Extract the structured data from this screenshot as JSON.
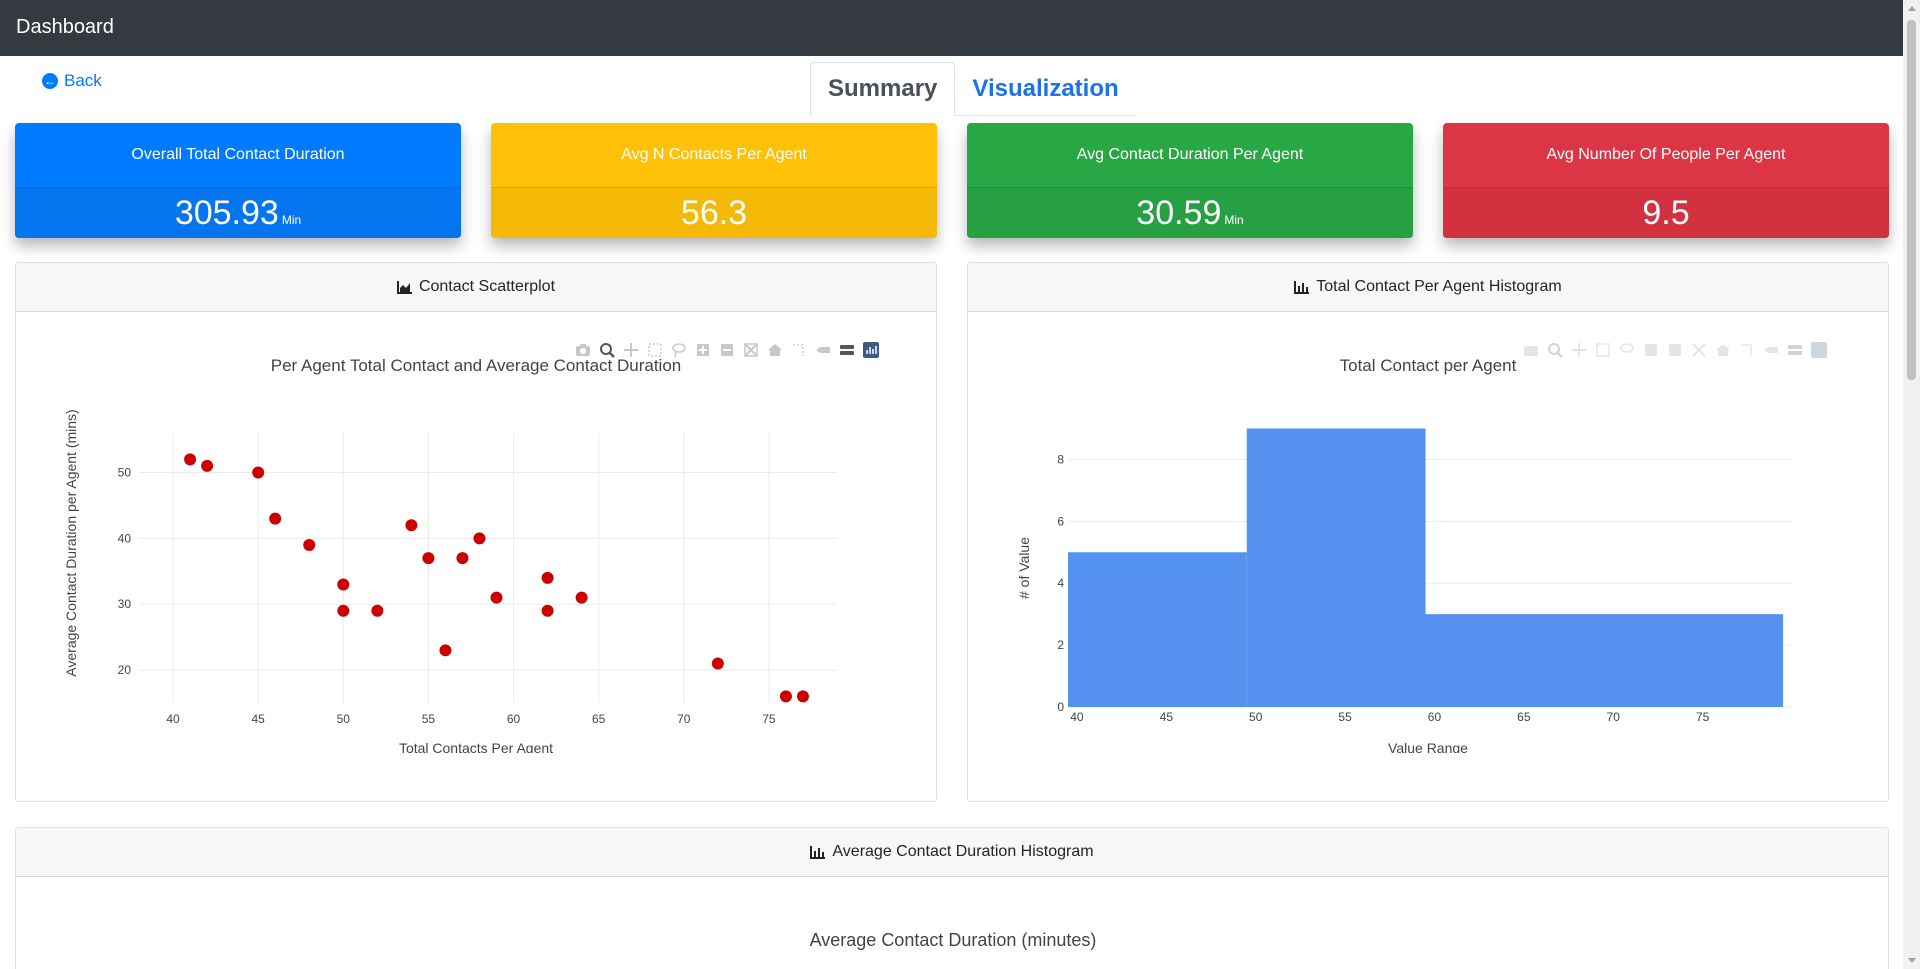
{
  "navbar": {
    "brand": "Dashboard"
  },
  "back": {
    "label": "Back"
  },
  "tabs": [
    {
      "label": "Summary",
      "active": true
    },
    {
      "label": "Visualization",
      "active": false
    }
  ],
  "stats": [
    {
      "title": "Overall Total Contact Duration",
      "value": "305.93",
      "unit": "Min",
      "color": "#007bff"
    },
    {
      "title": "Avg N Contacts Per Agent",
      "value": "56.3",
      "unit": "",
      "color": "#ffc107"
    },
    {
      "title": "Avg Contact Duration Per Agent",
      "value": "30.59",
      "unit": "Min",
      "color": "#28a745"
    },
    {
      "title": "Avg Number Of People Per Agent",
      "value": "9.5",
      "unit": "",
      "color": "#dc3545"
    }
  ],
  "cards": {
    "scatter": {
      "header": "Contact Scatterplot"
    },
    "histogram": {
      "header": "Total Contact Per Agent Histogram"
    },
    "avg_hist": {
      "header": "Average Contact Duration Histogram"
    }
  },
  "chart_data": [
    {
      "type": "scatter",
      "title": "Per Agent Total Contact and Average Contact Duration",
      "xlabel": "Total Contacts Per Agent",
      "ylabel": "Average Contact Duration per Agent (mins)",
      "xlim": [
        38,
        79
      ],
      "ylim": [
        15,
        56
      ],
      "xticks": [
        40,
        45,
        50,
        55,
        60,
        65,
        70,
        75
      ],
      "yticks": [
        20,
        30,
        40,
        50
      ],
      "grid": true,
      "marker_color": "#cc0000",
      "points": [
        [
          41,
          52
        ],
        [
          42,
          51
        ],
        [
          45,
          50
        ],
        [
          46,
          43
        ],
        [
          48,
          39
        ],
        [
          50,
          33
        ],
        [
          50,
          29
        ],
        [
          52,
          29
        ],
        [
          54,
          42
        ],
        [
          55,
          37
        ],
        [
          56,
          23
        ],
        [
          57,
          37
        ],
        [
          58,
          40
        ],
        [
          59,
          31
        ],
        [
          62,
          34
        ],
        [
          62,
          29
        ],
        [
          64,
          31
        ],
        [
          72,
          21
        ],
        [
          76,
          16
        ],
        [
          77,
          16
        ]
      ]
    },
    {
      "type": "bar",
      "title": "Total Contact per Agent",
      "xlabel": "Value Range",
      "ylabel": "# of Value",
      "xlim": [
        39.5,
        80
      ],
      "ylim": [
        0,
        9.5
      ],
      "xticks": [
        40,
        45,
        50,
        55,
        60,
        65,
        70,
        75
      ],
      "yticks": [
        0,
        2,
        4,
        6,
        8
      ],
      "grid": true,
      "bar_color": "#5591ee",
      "bins": [
        {
          "start": 39.5,
          "end": 49.5,
          "count": 5
        },
        {
          "start": 49.5,
          "end": 59.5,
          "count": 9
        },
        {
          "start": 59.5,
          "end": 79.5,
          "count": 3
        }
      ]
    },
    {
      "type": "bar",
      "title": "Average Contact Duration (minutes)"
    }
  ]
}
